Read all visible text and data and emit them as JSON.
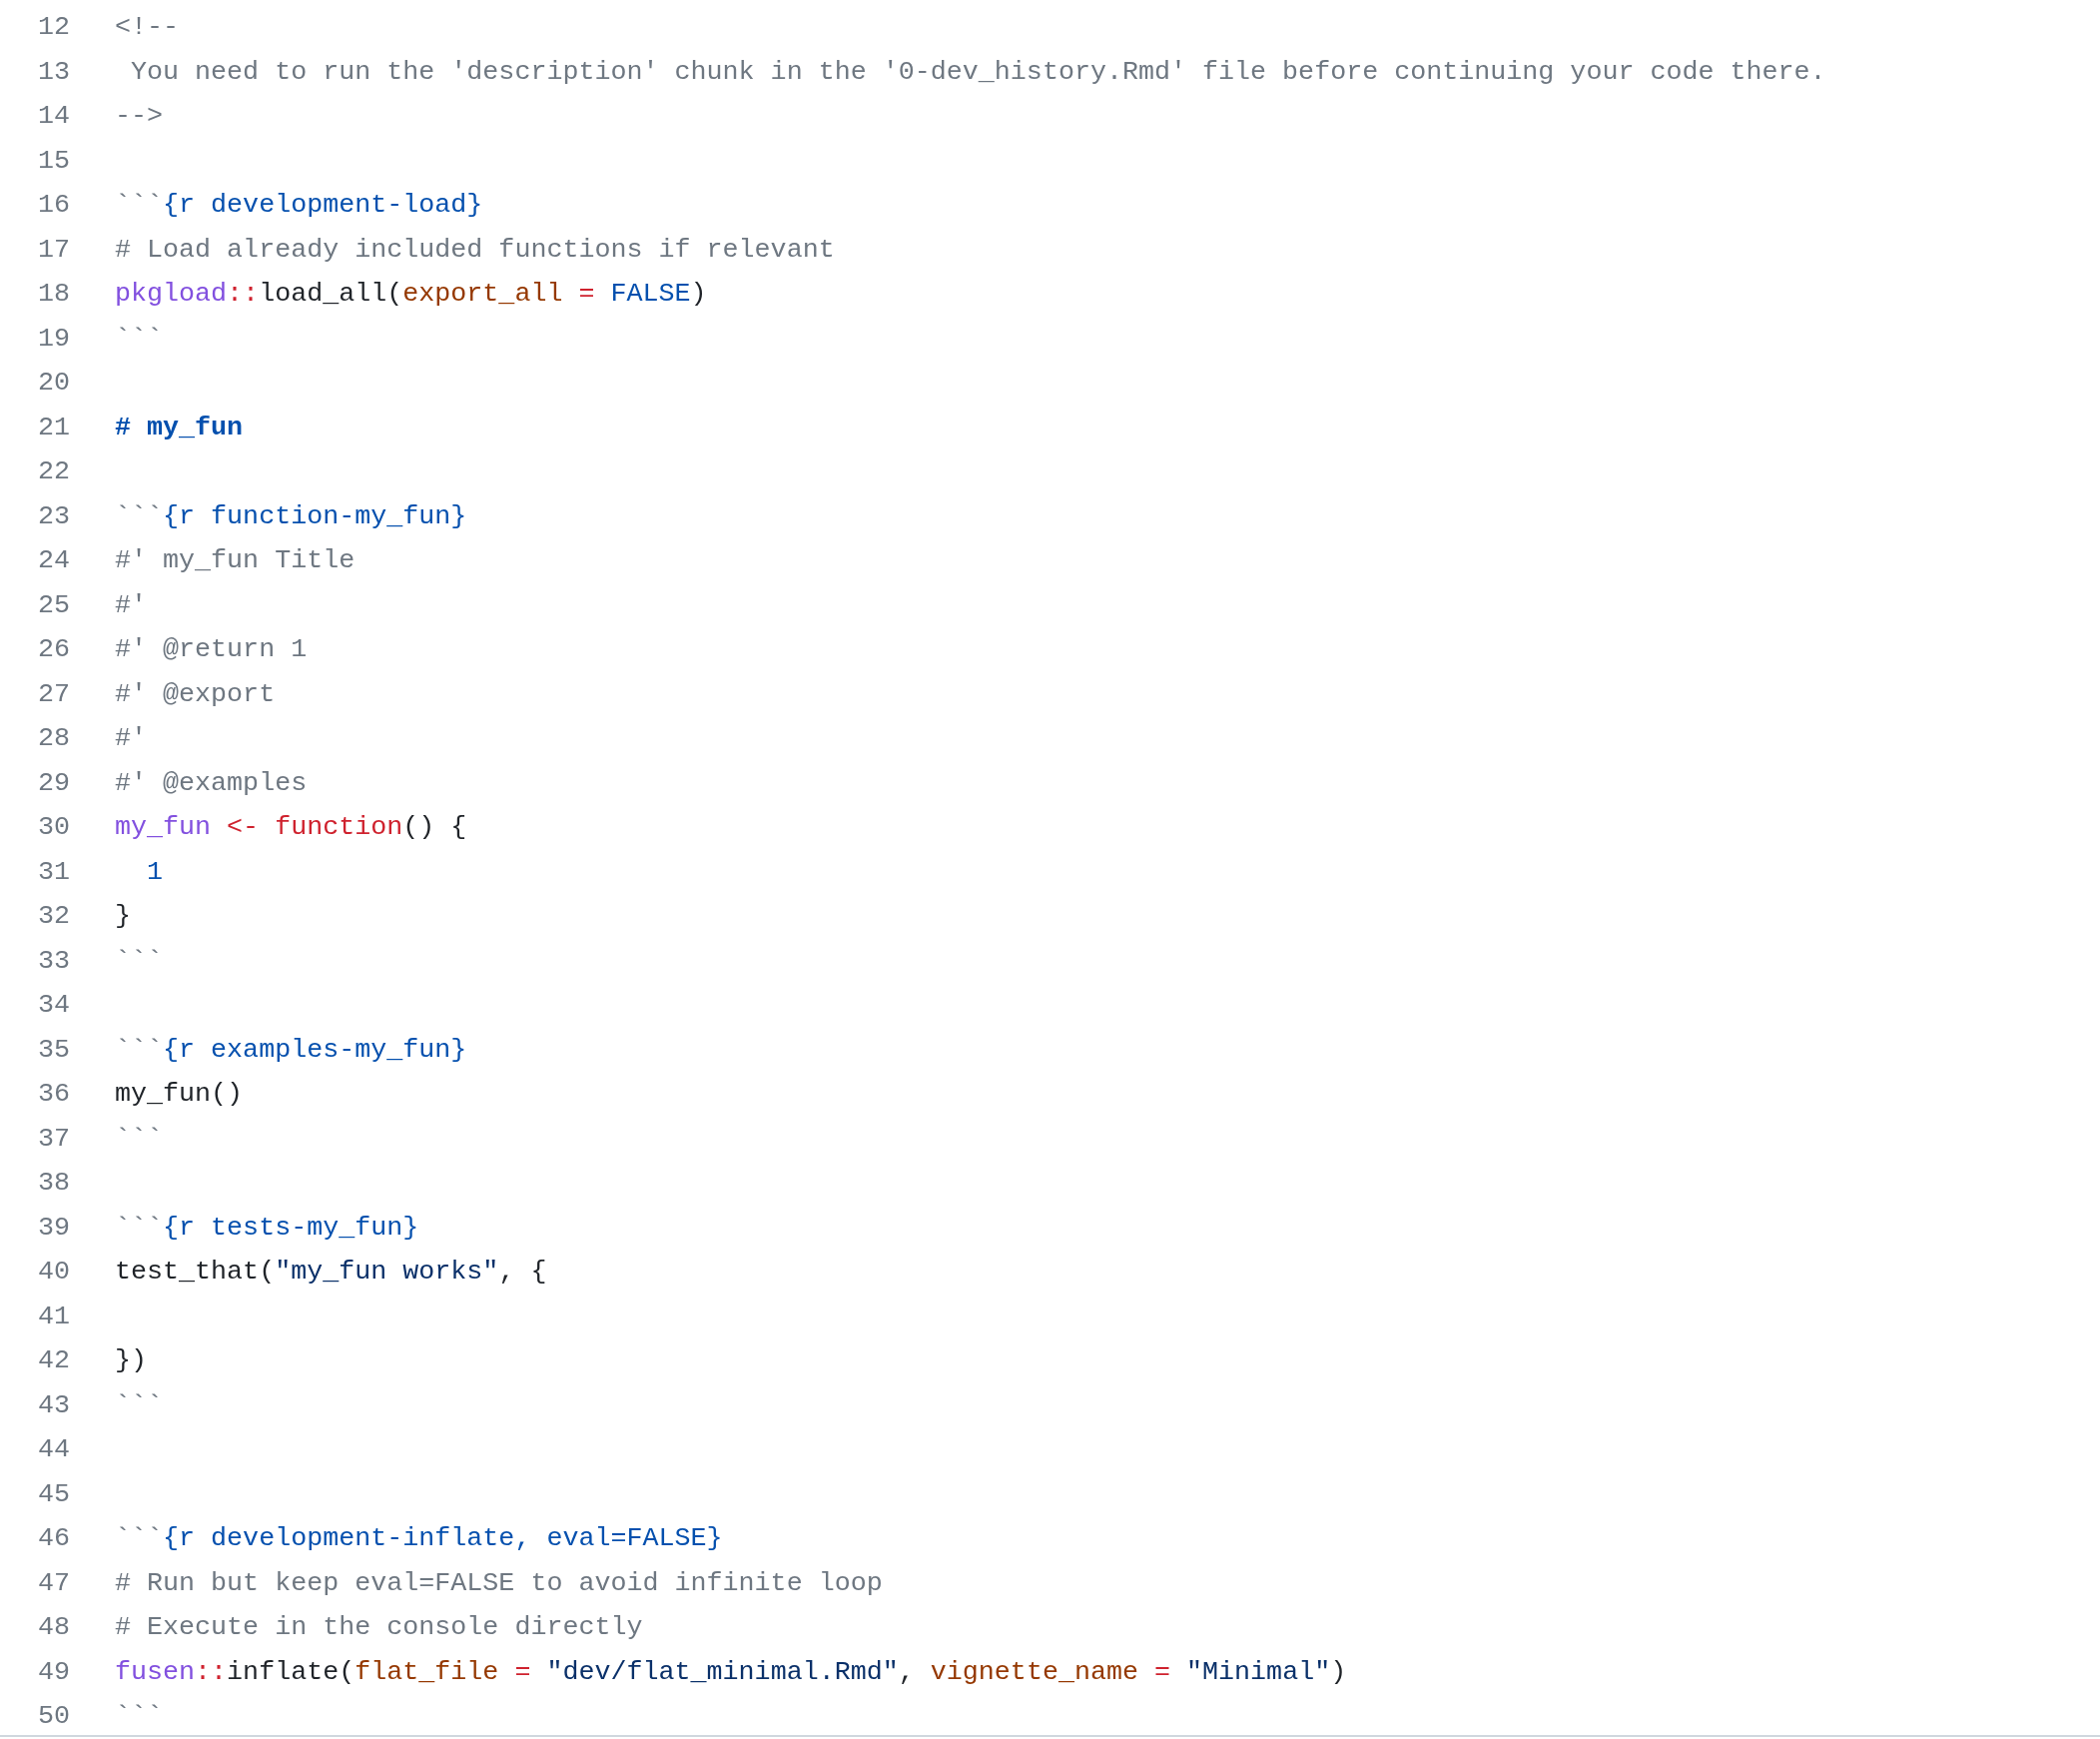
{
  "lines": [
    {
      "number": "12",
      "tokens": [
        {
          "kind": "comment",
          "text": "<!--"
        }
      ]
    },
    {
      "number": "13",
      "tokens": [
        {
          "kind": "comment",
          "text": " You need to run the 'description' chunk in the '0-dev_history.Rmd' file before continuing your code there."
        }
      ]
    },
    {
      "number": "14",
      "tokens": [
        {
          "kind": "comment",
          "text": "-->"
        }
      ]
    },
    {
      "number": "15"
    },
    {
      "number": "16",
      "tokens": [
        {
          "kind": "fence",
          "text": "```"
        },
        {
          "kind": "chunk",
          "text": "{r development-load}"
        }
      ]
    },
    {
      "number": "17",
      "tokens": [
        {
          "kind": "comment",
          "text": "# Load already included functions if relevant"
        }
      ]
    },
    {
      "number": "18",
      "tokens": [
        {
          "kind": "entity",
          "text": "pkgload"
        },
        {
          "kind": "keyword",
          "text": "::"
        },
        {
          "kind": "plain",
          "text": "load_all("
        },
        {
          "kind": "variable",
          "text": "export_all"
        },
        {
          "kind": "keyword",
          "text": " = "
        },
        {
          "kind": "constant",
          "text": "FALSE"
        },
        {
          "kind": "plain",
          "text": ")"
        }
      ]
    },
    {
      "number": "19",
      "tokens": [
        {
          "kind": "fence",
          "text": "```"
        }
      ]
    },
    {
      "number": "20"
    },
    {
      "number": "21",
      "tokens": [
        {
          "kind": "heading",
          "text": "# my_fun"
        }
      ]
    },
    {
      "number": "22"
    },
    {
      "number": "23",
      "tokens": [
        {
          "kind": "fence",
          "text": "```"
        },
        {
          "kind": "chunk",
          "text": "{r function-my_fun}"
        }
      ]
    },
    {
      "number": "24",
      "tokens": [
        {
          "kind": "comment",
          "text": "#' my_fun Title"
        }
      ]
    },
    {
      "number": "25",
      "tokens": [
        {
          "kind": "comment",
          "text": "#'"
        }
      ]
    },
    {
      "number": "26",
      "tokens": [
        {
          "kind": "comment",
          "text": "#' @return 1"
        }
      ]
    },
    {
      "number": "27",
      "tokens": [
        {
          "kind": "comment",
          "text": "#' @export"
        }
      ]
    },
    {
      "number": "28",
      "tokens": [
        {
          "kind": "comment",
          "text": "#'"
        }
      ]
    },
    {
      "number": "29",
      "tokens": [
        {
          "kind": "comment",
          "text": "#' @examples"
        }
      ]
    },
    {
      "number": "30",
      "tokens": [
        {
          "kind": "entity",
          "text": "my_fun"
        },
        {
          "kind": "keyword",
          "text": " <- function"
        },
        {
          "kind": "plain",
          "text": "() {"
        }
      ]
    },
    {
      "number": "31",
      "tokens": [
        {
          "kind": "constant",
          "text": "  1"
        }
      ]
    },
    {
      "number": "32",
      "tokens": [
        {
          "kind": "plain",
          "text": "}"
        }
      ]
    },
    {
      "number": "33",
      "tokens": [
        {
          "kind": "fence",
          "text": "```"
        }
      ]
    },
    {
      "number": "34"
    },
    {
      "number": "35",
      "tokens": [
        {
          "kind": "fence",
          "text": "```"
        },
        {
          "kind": "chunk",
          "text": "{r examples-my_fun}"
        }
      ]
    },
    {
      "number": "36",
      "tokens": [
        {
          "kind": "plain",
          "text": "my_fun()"
        }
      ]
    },
    {
      "number": "37",
      "tokens": [
        {
          "kind": "fence",
          "text": "```"
        }
      ]
    },
    {
      "number": "38"
    },
    {
      "number": "39",
      "tokens": [
        {
          "kind": "fence",
          "text": "```"
        },
        {
          "kind": "chunk",
          "text": "{r tests-my_fun}"
        }
      ]
    },
    {
      "number": "40",
      "tokens": [
        {
          "kind": "plain",
          "text": "test_that("
        },
        {
          "kind": "string",
          "text": "\"my_fun works\""
        },
        {
          "kind": "plain",
          "text": ", {"
        }
      ]
    },
    {
      "number": "41"
    },
    {
      "number": "42",
      "tokens": [
        {
          "kind": "plain",
          "text": "})"
        }
      ]
    },
    {
      "number": "43",
      "tokens": [
        {
          "kind": "fence",
          "text": "```"
        }
      ]
    },
    {
      "number": "44"
    },
    {
      "number": "45"
    },
    {
      "number": "46",
      "tokens": [
        {
          "kind": "fence",
          "text": "```"
        },
        {
          "kind": "chunk",
          "text": "{r development-inflate, eval=FALSE}"
        }
      ]
    },
    {
      "number": "47",
      "tokens": [
        {
          "kind": "comment",
          "text": "# Run but keep eval=FALSE to avoid infinite loop"
        }
      ]
    },
    {
      "number": "48",
      "tokens": [
        {
          "kind": "comment",
          "text": "# Execute in the console directly"
        }
      ]
    },
    {
      "number": "49",
      "tokens": [
        {
          "kind": "entity",
          "text": "fusen"
        },
        {
          "kind": "keyword",
          "text": "::"
        },
        {
          "kind": "plain",
          "text": "inflate("
        },
        {
          "kind": "variable",
          "text": "flat_file"
        },
        {
          "kind": "keyword",
          "text": " = "
        },
        {
          "kind": "string",
          "text": "\"dev/flat_minimal.Rmd\""
        },
        {
          "kind": "plain",
          "text": ", "
        },
        {
          "kind": "variable",
          "text": "vignette_name"
        },
        {
          "kind": "keyword",
          "text": " = "
        },
        {
          "kind": "string",
          "text": "\"Minimal\""
        },
        {
          "kind": "plain",
          "text": ")"
        }
      ]
    },
    {
      "number": "50",
      "tokens": [
        {
          "kind": "fence",
          "text": "```"
        }
      ]
    }
  ]
}
